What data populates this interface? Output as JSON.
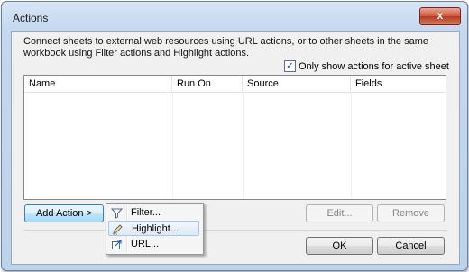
{
  "window": {
    "title": "Actions",
    "close_label": "x"
  },
  "description": "Connect sheets to external web resources using URL actions, or to other sheets in the same workbook using Filter actions and Highlight actions.",
  "filter_option": {
    "checked": true,
    "label": "Only show actions for active sheet"
  },
  "table": {
    "columns": [
      "Name",
      "Run On",
      "Source",
      "Fields"
    ],
    "rows": []
  },
  "buttons": {
    "add_action": "Add Action >",
    "edit": "Edit...",
    "remove": "Remove",
    "ok": "OK",
    "cancel": "Cancel"
  },
  "add_action_menu": {
    "items": [
      {
        "label": "Filter...",
        "icon": "filter-icon"
      },
      {
        "label": "Highlight...",
        "icon": "highlight-pencil-icon",
        "highlighted": true
      },
      {
        "label": "URL...",
        "icon": "url-link-icon"
      }
    ]
  }
}
